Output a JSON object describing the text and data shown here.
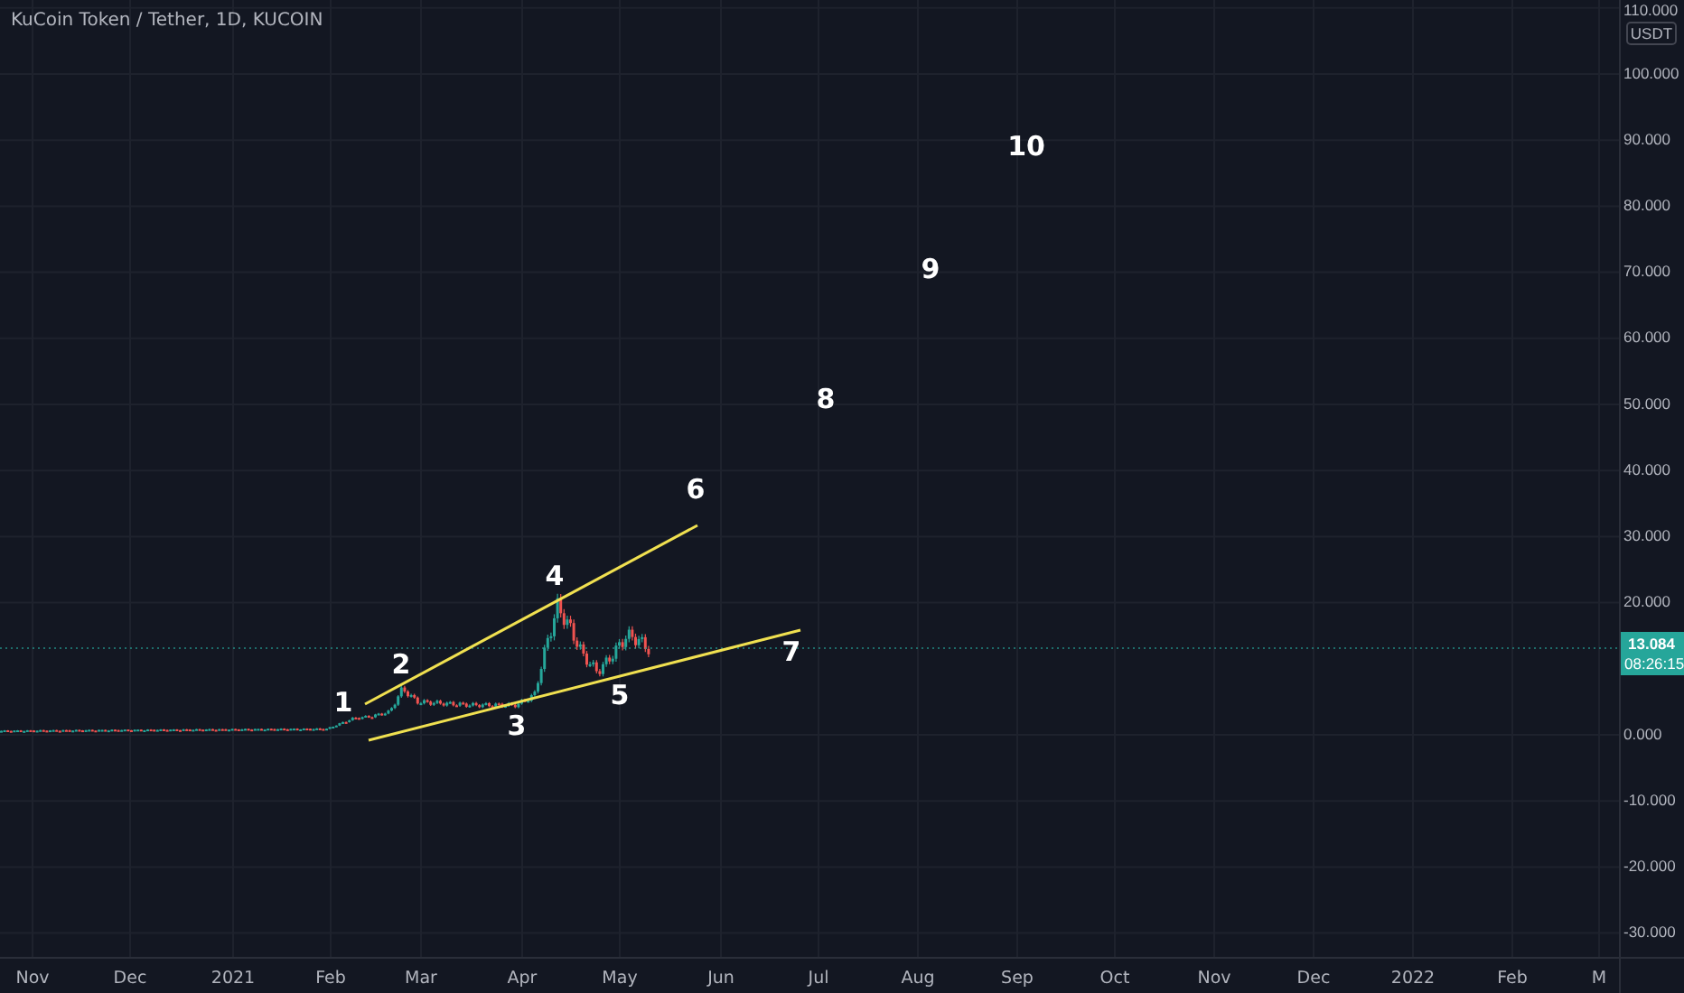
{
  "chart_title": "KuCoin Token / Tether, 1D, KUCOIN",
  "price_axis": {
    "unit": "USDT",
    "labels": [
      "110.000",
      "100.000",
      "90.000",
      "80.000",
      "70.000",
      "60.000",
      "50.000",
      "40.000",
      "30.000",
      "20.000",
      "0.000",
      "-10.000",
      "-20.000",
      "-30.000"
    ]
  },
  "time_axis": {
    "labels": [
      "Nov",
      "Dec",
      "2021",
      "Feb",
      "Mar",
      "Apr",
      "May",
      "Jun",
      "Jul",
      "Aug",
      "Sep",
      "Oct",
      "Nov",
      "Dec",
      "2022",
      "Feb",
      "M"
    ]
  },
  "last_price": {
    "value": "13.084",
    "countdown": "08:26:15"
  },
  "wave_labels": [
    "1",
    "2",
    "3",
    "4",
    "5",
    "6",
    "7",
    "8",
    "9",
    "10"
  ]
}
